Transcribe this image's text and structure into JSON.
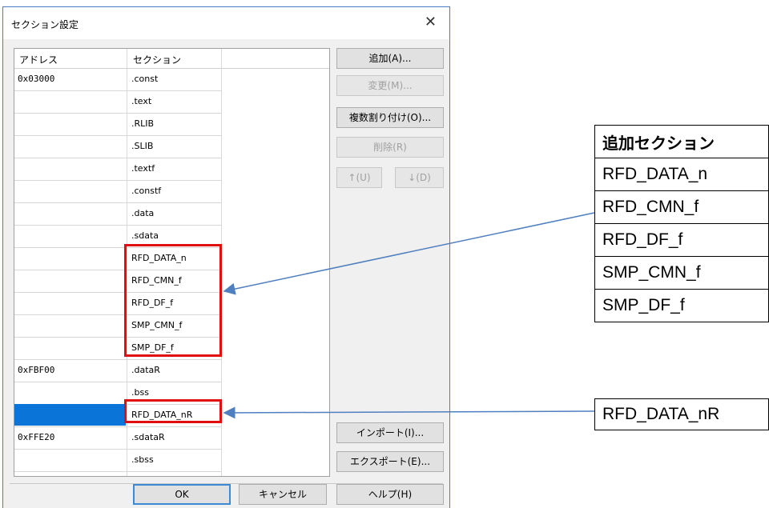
{
  "dialog": {
    "title": "セクション設定",
    "close_glyph": "✕",
    "columns": {
      "address": "アドレス",
      "section": "セクション"
    },
    "rows": [
      {
        "address": "0x03000",
        "section": ".const"
      },
      {
        "address": "",
        "section": ".text"
      },
      {
        "address": "",
        "section": ".RLIB"
      },
      {
        "address": "",
        "section": ".SLIB"
      },
      {
        "address": "",
        "section": ".textf"
      },
      {
        "address": "",
        "section": ".constf"
      },
      {
        "address": "",
        "section": ".data"
      },
      {
        "address": "",
        "section": ".sdata"
      },
      {
        "address": "",
        "section": "RFD_DATA_n"
      },
      {
        "address": "",
        "section": "RFD_CMN_f"
      },
      {
        "address": "",
        "section": "RFD_DF_f"
      },
      {
        "address": "",
        "section": "SMP_CMN_f"
      },
      {
        "address": "",
        "section": "SMP_DF_f"
      },
      {
        "address": "0xFBF00",
        "section": ".dataR"
      },
      {
        "address": "",
        "section": ".bss"
      },
      {
        "address": "",
        "section": "RFD_DATA_nR",
        "selected": true
      },
      {
        "address": "0xFFE20",
        "section": ".sdataR"
      },
      {
        "address": "",
        "section": ".sbss"
      }
    ],
    "buttons": {
      "add": "追加(A)...",
      "change": "変更(M)...",
      "multi_assign": "複数割り付け(O)...",
      "delete": "削除(R)",
      "up": "↑(U)",
      "down": "↓(D)",
      "import": "インポート(I)...",
      "export": "エクスポート(E)...",
      "ok": "OK",
      "cancel": "キャンセル",
      "help": "ヘルプ(H)"
    },
    "selection_color": "#0a74d9"
  },
  "annotation": {
    "added_sections_header": "追加セクション",
    "added_sections": [
      "RFD_DATA_n",
      "RFD_CMN_f",
      "RFD_DF_f",
      "SMP_CMN_f",
      "SMP_DF_f"
    ],
    "added_r_section": "RFD_DATA_nR",
    "highlight_color": "#e01010",
    "arrow_color": "#4f7fbf"
  }
}
